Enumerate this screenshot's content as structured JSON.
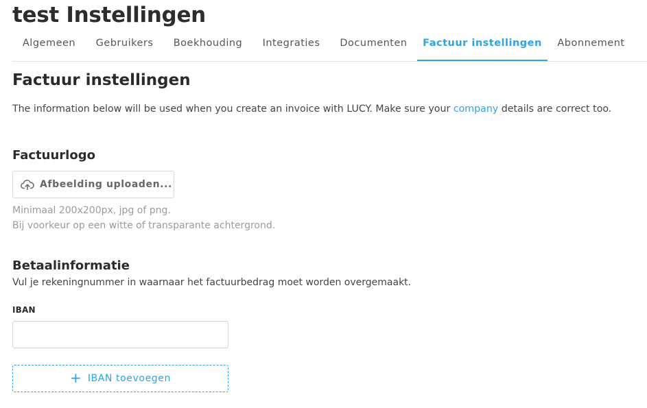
{
  "page": {
    "title": "test Instellingen"
  },
  "tabs": [
    {
      "label": "Algemeen"
    },
    {
      "label": "Gebruikers"
    },
    {
      "label": "Boekhouding"
    },
    {
      "label": "Integraties"
    },
    {
      "label": "Documenten"
    },
    {
      "label": "Factuur instellingen",
      "active": true
    },
    {
      "label": "Abonnement"
    }
  ],
  "section": {
    "title": "Factuur instellingen",
    "intro_before": "The information below will be used when you create an invoice with LUCY. Make sure your ",
    "intro_link": "company",
    "intro_after": " details are correct too."
  },
  "logo": {
    "heading": "Factuurlogo",
    "upload_label": "Afbeelding uploaden...",
    "upload_icon": "cloud-upload-icon",
    "hint_line1": "Minimaal 200x200px, jpg of png.",
    "hint_line2": "Bij voorkeur op een witte of transparante achtergrond."
  },
  "payment": {
    "heading": "Betaalinformatie",
    "description": "Vul je rekeningnummer in waarnaar het factuurbedrag moet worden overgemaakt.",
    "iban_label": "IBAN",
    "iban_value": "",
    "add_icon": "plus-icon",
    "add_label": "IBAN toevoegen"
  },
  "colors": {
    "accent": "#2aa6e8",
    "text": "#2b2b2b",
    "muted": "#9b9b9b",
    "border": "#d9d9d9"
  }
}
